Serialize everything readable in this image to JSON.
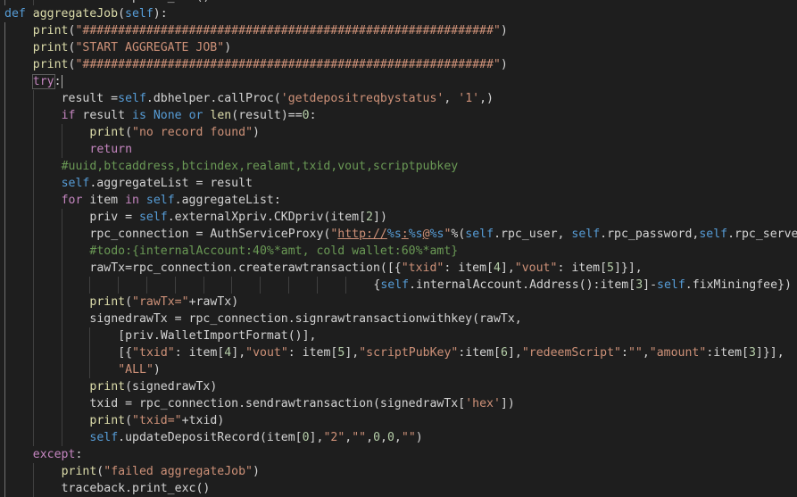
{
  "editor": {
    "theme_background": "#1e1e1e",
    "lines": [
      {
        "indent": 2,
        "tokens": [
          [
            "op",
            "traceback.print_exc()"
          ]
        ]
      },
      {
        "indent": 0,
        "tokens": [
          [
            "kw",
            "def"
          ],
          [
            "op",
            " "
          ],
          [
            "fn",
            "aggregateJob"
          ],
          [
            "op",
            "("
          ],
          [
            "self",
            "self"
          ],
          [
            "op",
            "):"
          ]
        ]
      },
      {
        "indent": 1,
        "tokens": [
          [
            "fn",
            "print"
          ],
          [
            "op",
            "("
          ],
          [
            "str",
            "\"##########################################################\""
          ],
          [
            "op",
            ")"
          ]
        ]
      },
      {
        "indent": 1,
        "tokens": [
          [
            "fn",
            "print"
          ],
          [
            "op",
            "("
          ],
          [
            "str",
            "\"START AGGREGATE JOB\""
          ],
          [
            "op",
            ")"
          ]
        ]
      },
      {
        "indent": 1,
        "tokens": [
          [
            "fn",
            "print"
          ],
          [
            "op",
            "("
          ],
          [
            "str",
            "\"##########################################################\""
          ],
          [
            "op",
            ")"
          ]
        ]
      },
      {
        "indent": 1,
        "tokens": [
          [
            "trybox",
            "try"
          ],
          [
            "op",
            ":"
          ],
          [
            "cursor",
            ""
          ]
        ]
      },
      {
        "indent": 2,
        "tokens": [
          [
            "op",
            "result ="
          ],
          [
            "self",
            "self"
          ],
          [
            "op",
            ".dbhelper.callProc("
          ],
          [
            "str",
            "'getdepositreqbystatus'"
          ],
          [
            "op",
            ", "
          ],
          [
            "str",
            "'1'"
          ],
          [
            "op",
            ",)"
          ]
        ]
      },
      {
        "indent": 2,
        "tokens": [
          [
            "ctl",
            "if"
          ],
          [
            "op",
            " result "
          ],
          [
            "kw",
            "is"
          ],
          [
            "op",
            " "
          ],
          [
            "kw",
            "None"
          ],
          [
            "op",
            " "
          ],
          [
            "kw",
            "or"
          ],
          [
            "op",
            " "
          ],
          [
            "fn",
            "len"
          ],
          [
            "op",
            "(result)=="
          ],
          [
            "num",
            "0"
          ],
          [
            "op",
            ":"
          ]
        ]
      },
      {
        "indent": 3,
        "tokens": [
          [
            "fn",
            "print"
          ],
          [
            "op",
            "("
          ],
          [
            "str",
            "\"no record found\""
          ],
          [
            "op",
            ")"
          ]
        ]
      },
      {
        "indent": 3,
        "tokens": [
          [
            "ctl",
            "return"
          ]
        ]
      },
      {
        "indent": 2,
        "tokens": [
          [
            "cm",
            "#uuid,btcaddress,btcindex,realamt,txid,vout,scriptpubkey"
          ]
        ]
      },
      {
        "indent": 2,
        "tokens": [
          [
            "self",
            "self"
          ],
          [
            "op",
            ".aggregateList = result"
          ]
        ]
      },
      {
        "indent": 2,
        "tokens": [
          [
            "ctl",
            "for"
          ],
          [
            "op",
            " item "
          ],
          [
            "ctl",
            "in"
          ],
          [
            "op",
            " "
          ],
          [
            "self",
            "self"
          ],
          [
            "op",
            ".aggregateList:"
          ]
        ]
      },
      {
        "indent": 3,
        "tokens": [
          [
            "op",
            "priv = "
          ],
          [
            "self",
            "self"
          ],
          [
            "op",
            ".externalXpriv.CKDpriv(item["
          ],
          [
            "num",
            "2"
          ],
          [
            "op",
            "])"
          ]
        ]
      },
      {
        "indent": 3,
        "tokens": [
          [
            "op",
            "rpc_connection = AuthServiceProxy("
          ],
          [
            "str",
            "\""
          ],
          [
            "url",
            "http://"
          ],
          [
            "fmt",
            "%s"
          ],
          [
            "url",
            ":"
          ],
          [
            "fmt",
            "%s"
          ],
          [
            "url",
            "@"
          ],
          [
            "fmt",
            "%s"
          ],
          [
            "str",
            "\""
          ],
          [
            "op",
            "%("
          ],
          [
            "self",
            "self"
          ],
          [
            "op",
            ".rpc_user, "
          ],
          [
            "self",
            "self"
          ],
          [
            "op",
            ".rpc_password,"
          ],
          [
            "self",
            "self"
          ],
          [
            "op",
            ".rpc_server))"
          ]
        ]
      },
      {
        "indent": 3,
        "tokens": [
          [
            "cm",
            "#todo:{internalAccount:40%*amt, cold wallet:60%*amt}"
          ]
        ]
      },
      {
        "indent": 3,
        "tokens": [
          [
            "op",
            "rawTx=rpc_connection.createrawtransaction([{"
          ],
          [
            "str",
            "\"txid\""
          ],
          [
            "op",
            ": item["
          ],
          [
            "num",
            "4"
          ],
          [
            "op",
            "],"
          ],
          [
            "str",
            "\"vout\""
          ],
          [
            "op",
            ": item["
          ],
          [
            "num",
            "5"
          ],
          [
            "op",
            "]}],"
          ]
        ]
      },
      {
        "indent": 13,
        "tokens": [
          [
            "op",
            "{"
          ],
          [
            "self",
            "self"
          ],
          [
            "op",
            ".internalAccount.Address():item["
          ],
          [
            "num",
            "3"
          ],
          [
            "op",
            "]-"
          ],
          [
            "self",
            "self"
          ],
          [
            "op",
            ".fixMiningfee})"
          ]
        ]
      },
      {
        "indent": 3,
        "tokens": [
          [
            "fn",
            "print"
          ],
          [
            "op",
            "("
          ],
          [
            "str",
            "\"rawTx=\""
          ],
          [
            "op",
            "+rawTx)"
          ]
        ]
      },
      {
        "indent": 3,
        "tokens": [
          [
            "op",
            "signedrawTx = rpc_connection.signrawtransactionwithkey(rawTx,"
          ]
        ]
      },
      {
        "indent": 4,
        "tokens": [
          [
            "op",
            "[priv.WalletImportFormat()],"
          ]
        ]
      },
      {
        "indent": 4,
        "tokens": [
          [
            "op",
            "[{"
          ],
          [
            "str",
            "\"txid\""
          ],
          [
            "op",
            ": item["
          ],
          [
            "num",
            "4"
          ],
          [
            "op",
            "],"
          ],
          [
            "str",
            "\"vout\""
          ],
          [
            "op",
            ": item["
          ],
          [
            "num",
            "5"
          ],
          [
            "op",
            "],"
          ],
          [
            "str",
            "\"scriptPubKey\""
          ],
          [
            "op",
            ":item["
          ],
          [
            "num",
            "6"
          ],
          [
            "op",
            "],"
          ],
          [
            "str",
            "\"redeemScript\""
          ],
          [
            "op",
            ":"
          ],
          [
            "str",
            "\"\""
          ],
          [
            "op",
            ","
          ],
          [
            "str",
            "\"amount\""
          ],
          [
            "op",
            ":item["
          ],
          [
            "num",
            "3"
          ],
          [
            "op",
            "]}],"
          ]
        ]
      },
      {
        "indent": 4,
        "tokens": [
          [
            "str",
            "\"ALL\""
          ],
          [
            "op",
            ")"
          ]
        ]
      },
      {
        "indent": 3,
        "tokens": [
          [
            "fn",
            "print"
          ],
          [
            "op",
            "(signedrawTx)"
          ]
        ]
      },
      {
        "indent": 3,
        "tokens": [
          [
            "op",
            "txid = rpc_connection.sendrawtransaction(signedrawTx["
          ],
          [
            "str",
            "'hex'"
          ],
          [
            "op",
            "])"
          ]
        ]
      },
      {
        "indent": 3,
        "tokens": [
          [
            "fn",
            "print"
          ],
          [
            "op",
            "("
          ],
          [
            "str",
            "\"txid=\""
          ],
          [
            "op",
            "+txid)"
          ]
        ]
      },
      {
        "indent": 3,
        "tokens": [
          [
            "self",
            "self"
          ],
          [
            "op",
            ".updateDepositRecord(item["
          ],
          [
            "num",
            "0"
          ],
          [
            "op",
            "],"
          ],
          [
            "str",
            "\"2\""
          ],
          [
            "op",
            ","
          ],
          [
            "str",
            "\"\""
          ],
          [
            "op",
            ","
          ],
          [
            "num",
            "0"
          ],
          [
            "op",
            ","
          ],
          [
            "num",
            "0"
          ],
          [
            "op",
            ","
          ],
          [
            "str",
            "\"\""
          ],
          [
            "op",
            ")"
          ]
        ]
      },
      {
        "indent": 1,
        "tokens": [
          [
            "ctl",
            "except"
          ],
          [
            "op",
            ":"
          ]
        ]
      },
      {
        "indent": 2,
        "tokens": [
          [
            "fn",
            "print"
          ],
          [
            "op",
            "("
          ],
          [
            "str",
            "\"failed aggregateJob\""
          ],
          [
            "op",
            ")"
          ]
        ]
      },
      {
        "indent": 2,
        "tokens": [
          [
            "op",
            "traceback.print_exc()"
          ]
        ]
      }
    ]
  }
}
